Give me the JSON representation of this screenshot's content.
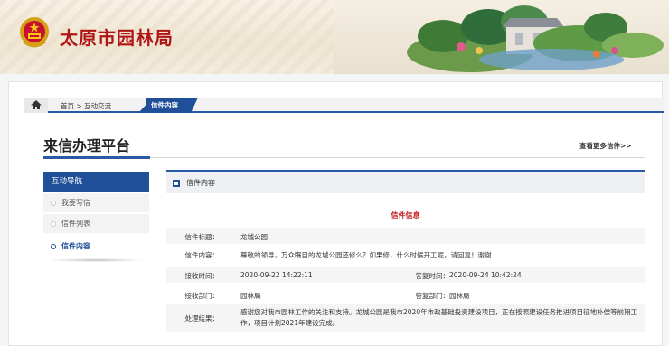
{
  "header": {
    "site_title": "太原市园林局"
  },
  "breadcrumb": {
    "path": "首页 > 互动交流",
    "current": "信件内容"
  },
  "page": {
    "title": "来信办理平台",
    "more_link": "查看更多信件>>"
  },
  "sidebar": {
    "heading": "互动导航",
    "items": [
      {
        "label": "我要写信"
      },
      {
        "label": "信件列表"
      },
      {
        "label": "信件内容"
      }
    ]
  },
  "section": {
    "heading": "信件内容"
  },
  "letter": {
    "info_title": "信件信息",
    "subject_label": "信件标题：",
    "subject": "龙城公园",
    "content_label": "信件内容：",
    "content": "尊敬的领导，万众瞩目的龙城公园还修么？如果修，什么时候开工呢，请回复！谢谢",
    "received_label": "接收时间：",
    "received": "2020-09-22 14:22:11",
    "replied_label": "答复时间：",
    "replied": "2020-09-24 10:42:24",
    "recv_dept_label": "接收部门：",
    "recv_dept": "园林局",
    "reply_dept_label": "答复部门：",
    "reply_dept": "园林局",
    "result_label": "处理结果：",
    "result": "感谢您对我市园林工作的关注和支持。龙城公园是我市2020年市政基础投资建设项目，正在按照建设任务推进项目征地补偿等前期工作，项目计划2021年建设完成。"
  },
  "colors": {
    "brand_red": "#b01616",
    "nav_blue": "#1f4f99"
  }
}
